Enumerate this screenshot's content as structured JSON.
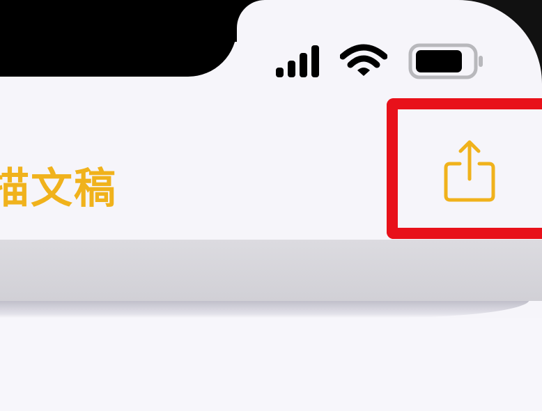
{
  "nav": {
    "title": "描文稿",
    "share_icon": "share-icon"
  },
  "status_bar": {
    "signal_icon": "cellular-signal-icon",
    "wifi_icon": "wifi-icon",
    "battery_icon": "battery-icon"
  },
  "colors": {
    "accent": "#f0b21c",
    "highlight": "#e8111a",
    "background": "#f6f5fa"
  }
}
